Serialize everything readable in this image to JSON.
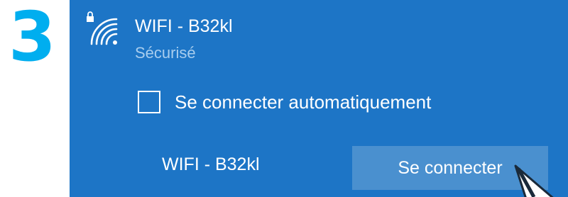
{
  "step": {
    "number": "3",
    "color": "#00aeef"
  },
  "wifi_panel": {
    "background": "#1d75c6",
    "icon": "secured-wifi-icon",
    "network_name": "WIFI - B32kl",
    "status": "Sécurisé",
    "auto_connect": {
      "label": "Se connecter automatiquement",
      "checked": false
    },
    "connect_network_label": "WIFI - B32kl",
    "connect_button_label": "Se connecter"
  },
  "cursor": {
    "icon": "mouse-pointer-icon"
  }
}
